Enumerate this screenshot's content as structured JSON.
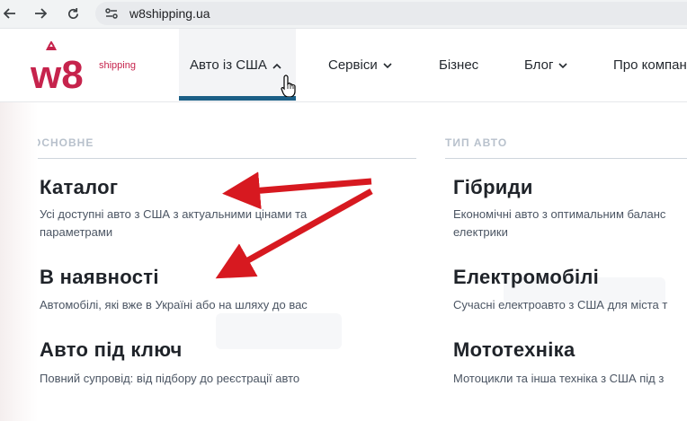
{
  "browser": {
    "url": "w8shipping.ua",
    "icons": [
      "back-arrow-icon",
      "forward-arrow-icon",
      "reload-icon",
      "site-info-icon"
    ]
  },
  "header": {
    "logo_mark": "w8",
    "logo_text": "shipping",
    "brand_color": "#c6234c",
    "accent_color": "#1b5f86",
    "menu": [
      {
        "label": "Авто із США",
        "has_dropdown": true,
        "active": true
      },
      {
        "label": "Сервіси",
        "has_dropdown": true
      },
      {
        "label": "Бізнес",
        "has_dropdown": false
      },
      {
        "label": "Блог",
        "has_dropdown": true
      },
      {
        "label": "Про компан",
        "has_dropdown": false
      }
    ]
  },
  "dropdown": {
    "columns": [
      {
        "heading": "ОСНОВНЕ",
        "items": [
          {
            "title": "Каталог",
            "desc_line1": "Усі доступні авто з США з актуальними цінами та",
            "desc_line2": "параметрами"
          },
          {
            "title": "В наявності",
            "desc_line1": "Автомобілі, які вже в Україні або на шляху до вас"
          },
          {
            "title": "Авто під ключ",
            "desc_line1": "Повний супровід: від підбору до реєстрації авто"
          }
        ]
      },
      {
        "heading": "ТИП АВТО",
        "items": [
          {
            "title": "Гібриди",
            "desc_line1": "Економічні авто з оптимальним баланс",
            "desc_line2": "електрики"
          },
          {
            "title": "Електромобілі",
            "desc_line1": "Сучасні електроавто з США для міста т"
          },
          {
            "title": "Мототехніка",
            "desc_line1": "Мотоцикли та інша техніка з США під з"
          }
        ]
      }
    ]
  },
  "annotation": {
    "arrow_color": "#d71920"
  }
}
